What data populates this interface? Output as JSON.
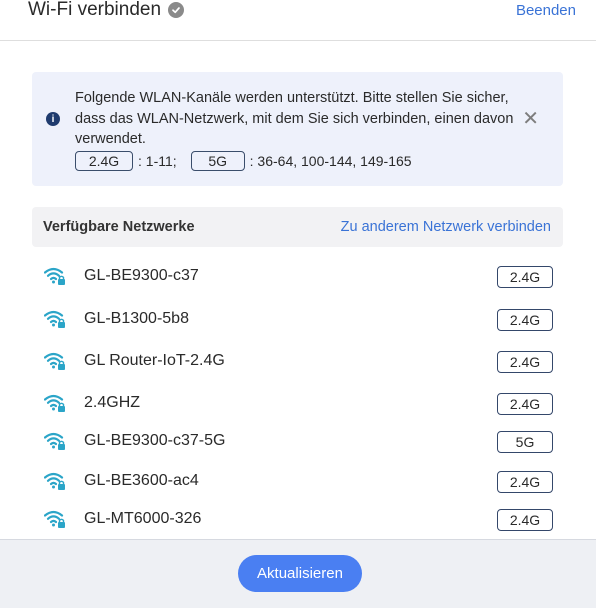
{
  "header": {
    "title": "Wi-Fi verbinden",
    "end_label": "Beenden"
  },
  "notice": {
    "text": "Folgende WLAN-Kanäle werden unterstützt. Bitte stellen Sie sicher, dass das WLAN-Netzwerk, mit dem Sie sich verbinden, einen davon verwendet.",
    "band1": "2.4G",
    "band1_channels": ": 1-11;",
    "band2": "5G",
    "band2_channels": ": 36-64, 100-144, 149-165"
  },
  "available": {
    "title": "Verfügbare Netzwerke",
    "other_link": "Zu anderem Netzwerk verbinden"
  },
  "networks": [
    {
      "name": "GL-BE9300-c37",
      "band": "2.4G"
    },
    {
      "name": "GL-B1300-5b8",
      "band": "2.4G"
    },
    {
      "name": "GL Router-IoT-2.4G",
      "band": "2.4G"
    },
    {
      "name": "2.4GHZ",
      "band": "2.4G"
    },
    {
      "name": "GL-BE9300-c37-5G",
      "band": "5G"
    },
    {
      "name": "GL-BE3600-ac4",
      "band": "2.4G"
    },
    {
      "name": "GL-MT6000-326",
      "band": "2.4G"
    }
  ],
  "footer": {
    "refresh_label": "Aktualisieren"
  },
  "colors": {
    "accent": "#4a7ff2",
    "link": "#3a73d6",
    "wifi_icon": "#2ba5c8"
  },
  "icons": {
    "title": "verified-check-icon",
    "info": "info-icon",
    "close": "close-icon",
    "network": "wifi-lock-icon"
  }
}
